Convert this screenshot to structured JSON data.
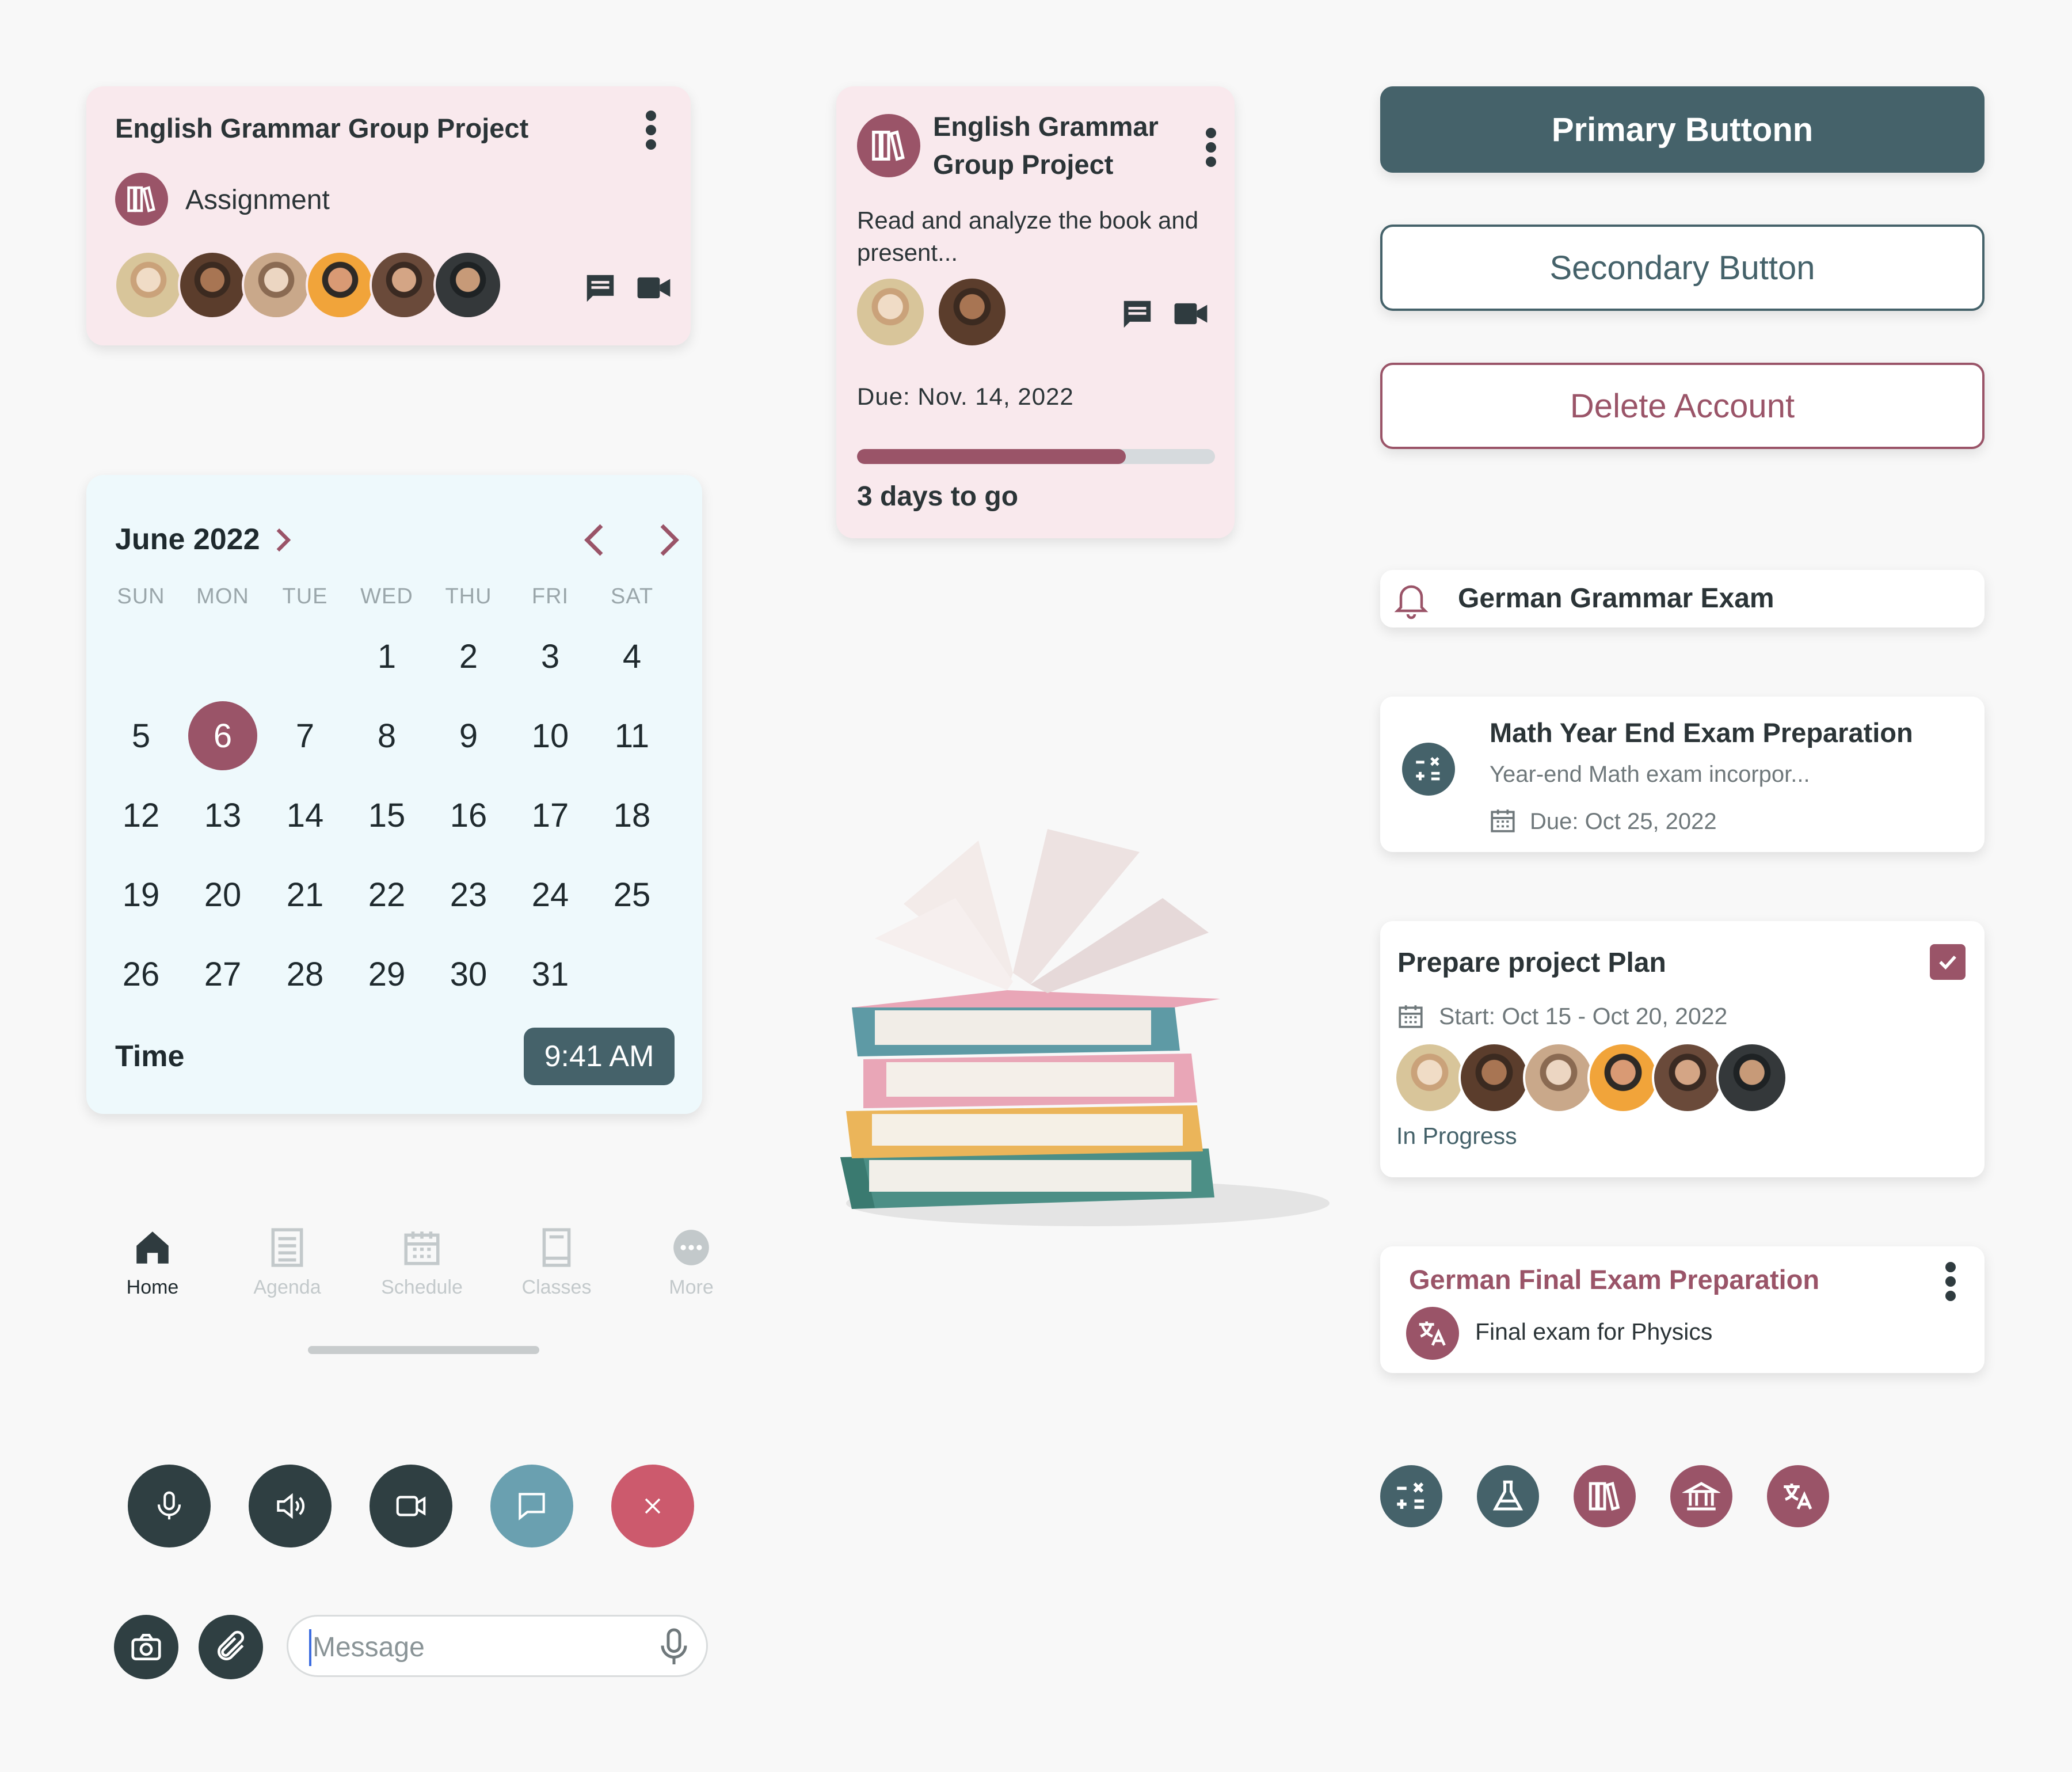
{
  "card1": {
    "title": "English Grammar Group Project",
    "type_label": "Assignment"
  },
  "card2": {
    "title_line1": "English Grammar",
    "title_line2": "Group Project",
    "description": "Read and analyze the book and present...",
    "due": "Due: Nov. 14, 2022",
    "progress": 0.75,
    "remaining": "3 days to go"
  },
  "buttons": {
    "primary": "Primary Buttonn",
    "secondary": "Secondary Button",
    "delete": "Delete Account"
  },
  "calendar": {
    "month": "June 2022",
    "weekdays": [
      "SUN",
      "MON",
      "TUE",
      "WED",
      "THU",
      "FRI",
      "SAT"
    ],
    "days": [
      "1",
      "2",
      "3",
      "4",
      "5",
      "6",
      "7",
      "8",
      "9",
      "10",
      "11",
      "12",
      "13",
      "14",
      "15",
      "16",
      "17",
      "18",
      "19",
      "20",
      "21",
      "22",
      "23",
      "24",
      "25",
      "26",
      "27",
      "28",
      "29",
      "30",
      "31"
    ],
    "selected_day": "6",
    "time_label": "Time",
    "time_value": "9:41 AM"
  },
  "reminder": {
    "title": "German Grammar Exam"
  },
  "math_card": {
    "title": "Math Year End Exam Preparation",
    "subtitle": "Year-end Math exam incorpor...",
    "due": "Due: Oct 25, 2022"
  },
  "task_card": {
    "title": "Prepare project Plan",
    "dates": "Start: Oct 15 - Oct 20, 2022",
    "status": "In Progress",
    "checked": true
  },
  "german_card": {
    "title": "German Final Exam Preparation",
    "subtitle": "Final exam for Physics"
  },
  "bottom_nav": [
    {
      "label": "Home",
      "icon": "home-icon",
      "active": true
    },
    {
      "label": "Agenda",
      "icon": "agenda-icon",
      "active": false
    },
    {
      "label": "Schedule",
      "icon": "schedule-icon",
      "active": false
    },
    {
      "label": "Classes",
      "icon": "classes-icon",
      "active": false
    },
    {
      "label": "More",
      "icon": "more-icon",
      "active": false
    }
  ],
  "call_controls": [
    "microphone-icon",
    "speaker-icon",
    "video-camera-icon",
    "chat-icon",
    "close-icon"
  ],
  "composer": {
    "placeholder": "Message"
  },
  "subject_icons": [
    "math-icon",
    "flask-icon",
    "books-icon",
    "institution-icon",
    "translate-icon"
  ],
  "colors": {
    "teal_dark": "#45626a",
    "rose": "#9a5468",
    "pink_bg": "#f9e9ed",
    "light_blue": "#eef9fc",
    "call_dark": "#2f3f42",
    "call_teal": "#6aa0b0",
    "call_red": "#cc5a6d"
  }
}
